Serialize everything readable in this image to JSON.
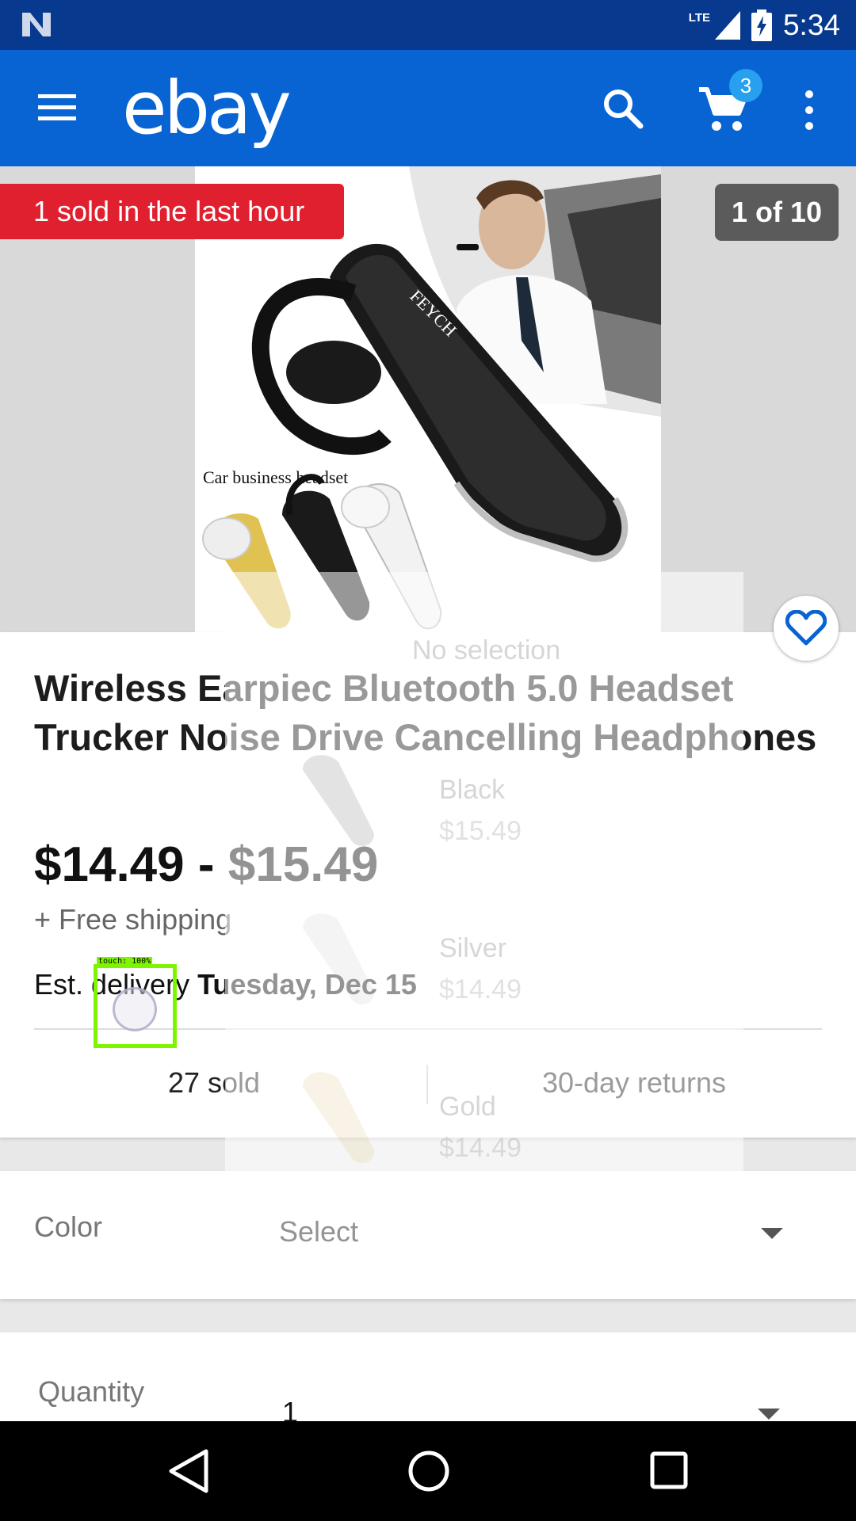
{
  "status_bar": {
    "network": "LTE",
    "time": "5:34",
    "icons": [
      "n-notification-icon",
      "signal-icon",
      "battery-charging-icon"
    ]
  },
  "app_bar": {
    "logo": "ebay",
    "cart_count": "3",
    "icons": [
      "menu-icon",
      "search-icon",
      "cart-icon",
      "more-vert-icon"
    ],
    "color": "#0764d2"
  },
  "hero": {
    "sold_banner": "1 sold in the last hour",
    "image_counter": "1 of 10",
    "image_caption": "Car business headset",
    "image_brand": "FEYCH",
    "banner_color": "#e0202f"
  },
  "product": {
    "title": "Wireless Earpiec Bluetooth 5.0 Headset Trucker Noise Drive Cancelling Headphones",
    "price": "$14.49 - $15.49",
    "shipping": "+ Free shipping",
    "delivery_prefix": "Est. delivery ",
    "delivery_date": "Tuesday, Dec 15",
    "sold": "27 sold",
    "returns": "30-day returns"
  },
  "color_option": {
    "label": "Color",
    "value": "Select"
  },
  "quantity_option": {
    "label": "Quantity",
    "value": "1"
  },
  "variation_overlay": {
    "header": "No selection",
    "items": [
      {
        "name": "Black",
        "price": "$15.49"
      },
      {
        "name": "Silver",
        "price": "$14.49"
      },
      {
        "name": "Gold",
        "price": "$14.49"
      }
    ]
  },
  "touch_indicator": {
    "label": "touch: 100%"
  }
}
